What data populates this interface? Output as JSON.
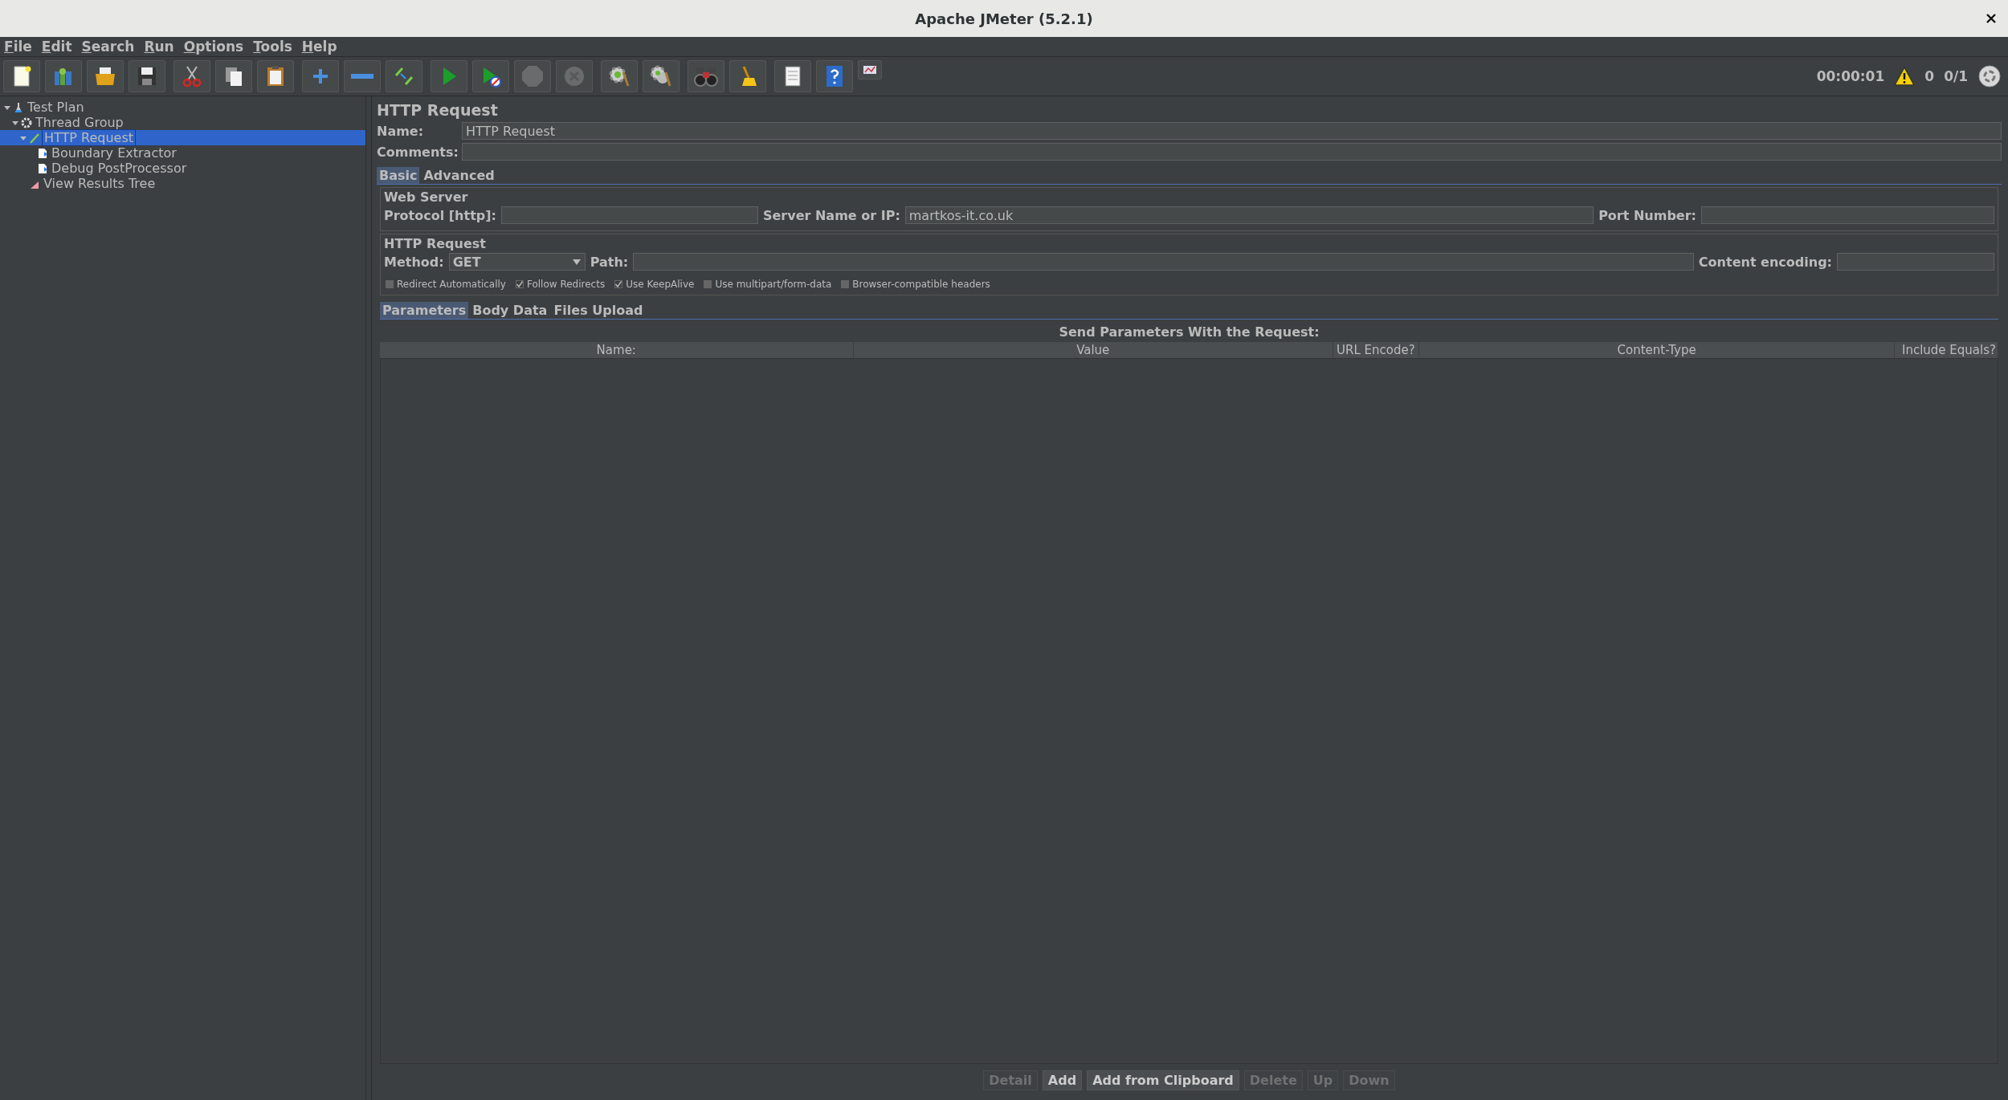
{
  "window": {
    "title": "Apache JMeter (5.2.1)"
  },
  "menu": [
    "File",
    "Edit",
    "Search",
    "Run",
    "Options",
    "Tools",
    "Help"
  ],
  "toolbar": [
    [
      {
        "kind": "new",
        "disabled": false
      },
      {
        "kind": "templates",
        "disabled": false
      },
      {
        "kind": "open",
        "disabled": false
      },
      {
        "kind": "save",
        "disabled": false
      }
    ],
    [
      {
        "kind": "cut",
        "disabled": false
      },
      {
        "kind": "copy",
        "disabled": false
      },
      {
        "kind": "paste",
        "disabled": false
      }
    ],
    [
      {
        "kind": "expand",
        "disabled": false
      },
      {
        "kind": "collapse",
        "disabled": false
      },
      {
        "kind": "toggle",
        "disabled": false
      }
    ],
    [
      {
        "kind": "start",
        "disabled": false
      },
      {
        "kind": "start_no_pause",
        "disabled": false
      },
      {
        "kind": "stop",
        "disabled": true
      },
      {
        "kind": "shutdown",
        "disabled": true
      }
    ],
    [
      {
        "kind": "clear",
        "disabled": false
      },
      {
        "kind": "clear_all",
        "disabled": false
      }
    ],
    [
      {
        "kind": "search",
        "disabled": false
      },
      {
        "kind": "reset_search",
        "disabled": false
      }
    ],
    [
      {
        "kind": "function_helper",
        "disabled": false
      },
      {
        "kind": "help",
        "disabled": false
      },
      {
        "kind": "log",
        "disabled": false
      }
    ]
  ],
  "status": {
    "timer": "00:00:01",
    "warnings": "0",
    "threads": "0/1"
  },
  "tree": [
    {
      "label": "Test Plan",
      "kind": "plan",
      "expanded": true,
      "selected": false,
      "children": [
        {
          "label": "Thread Group",
          "kind": "thread_group",
          "expanded": true,
          "selected": false,
          "children": [
            {
              "label": "HTTP Request",
              "kind": "sampler",
              "expanded": true,
              "selected": true,
              "children": [
                {
                  "label": "Boundary Extractor",
                  "kind": "post_processor",
                  "selected": false
                },
                {
                  "label": "Debug PostProcessor",
                  "kind": "post_processor",
                  "selected": false
                }
              ]
            },
            {
              "label": "View Results Tree",
              "kind": "listener",
              "selected": false
            }
          ]
        }
      ]
    }
  ],
  "panel": {
    "title": "HTTP Request",
    "name": {
      "label": "Name:",
      "value": "HTTP Request"
    },
    "comments": {
      "label": "Comments:"
    },
    "tabs": [
      {
        "label": "Basic",
        "selected": true
      },
      {
        "label": "Advanced",
        "selected": false
      }
    ],
    "web_server": {
      "title": "Web Server",
      "protocol": {
        "label": "Protocol [http]:"
      },
      "server": {
        "label": "Server Name or IP:",
        "value": "martkos-it.co.uk"
      },
      "port": {
        "label": "Port Number:"
      }
    },
    "http_request": {
      "title": "HTTP Request",
      "method": {
        "label": "Method:",
        "value": "GET"
      },
      "path": {
        "label": "Path:"
      },
      "encoding": {
        "label": "Content encoding:"
      },
      "options": [
        {
          "label": "Redirect Automatically",
          "checked": false
        },
        {
          "label": "Follow Redirects",
          "checked": true
        },
        {
          "label": "Use KeepAlive",
          "checked": true
        },
        {
          "label": "Use multipart/form-data",
          "checked": false
        },
        {
          "label": "Browser-compatible headers",
          "checked": false
        }
      ]
    },
    "sub_tabs": [
      {
        "label": "Parameters",
        "selected": true
      },
      {
        "label": "Body Data",
        "selected": false
      },
      {
        "label": "Files Upload",
        "selected": false
      }
    ],
    "table": {
      "title": "Send Parameters With the Request:",
      "columns": [
        "Name:",
        "Value",
        "URL Encode?",
        "Content-Type",
        "Include Equals?"
      ]
    },
    "buttons": [
      {
        "label": "Detail",
        "disabled": true
      },
      {
        "label": "Add",
        "disabled": false
      },
      {
        "label": "Add from Clipboard",
        "disabled": false
      },
      {
        "label": "Delete",
        "disabled": true
      },
      {
        "label": "Up",
        "disabled": true
      },
      {
        "label": "Down",
        "disabled": true
      }
    ]
  }
}
